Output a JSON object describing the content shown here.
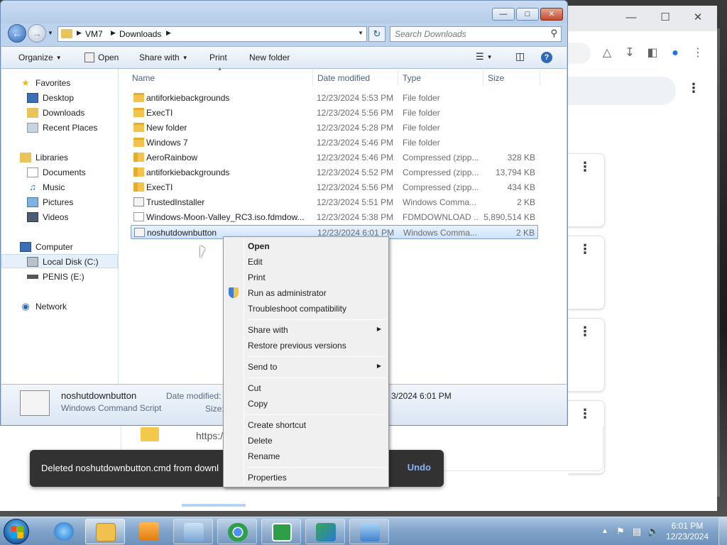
{
  "explorer": {
    "address": {
      "crumbs": [
        "VM7",
        "Downloads"
      ]
    },
    "search": {
      "placeholder": "Search Downloads"
    },
    "commands": {
      "organize": "Organize",
      "open": "Open",
      "share_with": "Share with",
      "print": "Print",
      "new_folder": "New folder"
    },
    "nav": {
      "favorites": "Favorites",
      "desktop": "Desktop",
      "downloads": "Downloads",
      "recent_places": "Recent Places",
      "libraries": "Libraries",
      "documents": "Documents",
      "music": "Music",
      "pictures": "Pictures",
      "videos": "Videos",
      "computer": "Computer",
      "local_disk": "Local Disk (C:)",
      "drive_e": "PENIS (E:)",
      "network": "Network"
    },
    "columns": {
      "name": "Name",
      "date_modified": "Date modified",
      "type": "Type",
      "size": "Size"
    },
    "files": [
      {
        "name": "antiforkiebackgrounds",
        "date": "12/23/2024 5:53 PM",
        "type": "File folder",
        "size": "",
        "icon": "folder"
      },
      {
        "name": "ExecTI",
        "date": "12/23/2024 5:56 PM",
        "type": "File folder",
        "size": "",
        "icon": "folder"
      },
      {
        "name": "New folder",
        "date": "12/23/2024 5:28 PM",
        "type": "File folder",
        "size": "",
        "icon": "folder"
      },
      {
        "name": "Windows 7",
        "date": "12/23/2024 5:46 PM",
        "type": "File folder",
        "size": "",
        "icon": "folder"
      },
      {
        "name": "AeroRainbow",
        "date": "12/23/2024 5:46 PM",
        "type": "Compressed (zipp...",
        "size": "328 KB",
        "icon": "zip"
      },
      {
        "name": "antiforkiebackgrounds",
        "date": "12/23/2024 5:52 PM",
        "type": "Compressed (zipp...",
        "size": "13,794 KB",
        "icon": "zip"
      },
      {
        "name": "ExecTI",
        "date": "12/23/2024 5:56 PM",
        "type": "Compressed (zipp...",
        "size": "434 KB",
        "icon": "zip"
      },
      {
        "name": "TrustedInstaller",
        "date": "12/23/2024 5:51 PM",
        "type": "Windows Comma...",
        "size": "2 KB",
        "icon": "script"
      },
      {
        "name": "Windows-Moon-Valley_RC3.iso.fdmdow...",
        "date": "12/23/2024 5:38 PM",
        "type": "FDMDOWNLOAD ...",
        "size": "5,890,514 KB",
        "icon": "doc"
      },
      {
        "name": "noshutdownbutton",
        "date": "12/23/2024 6:01 PM",
        "type": "Windows Comma...",
        "size": "2 KB",
        "icon": "script",
        "selected": true
      }
    ],
    "details": {
      "name": "noshutdownbutton",
      "type": "Windows Command Script",
      "date_label": "Date modified:",
      "date_value": "3/2024 6:01 PM",
      "size_label": "Size:"
    }
  },
  "context_menu": {
    "items": [
      "Open",
      "Edit",
      "Print",
      "Run as administrator",
      "Troubleshoot compatibility",
      "Share with",
      "Restore previous versions",
      "Send to",
      "Cut",
      "Copy",
      "Create shortcut",
      "Delete",
      "Rename",
      "Properties"
    ]
  },
  "toast": {
    "message": "Deleted noshutdownbutton.cmd from downl",
    "action": "Undo"
  },
  "chrome_bg": {
    "url_fragment": "https:/"
  },
  "taskbar": {
    "time": "6:01 PM",
    "date": "12/23/2024"
  },
  "colors": {
    "selection": "#cde3fb",
    "toast_bg": "#323232",
    "undo_link": "#8ab4f8",
    "taskbar": "#7fa2c8"
  }
}
